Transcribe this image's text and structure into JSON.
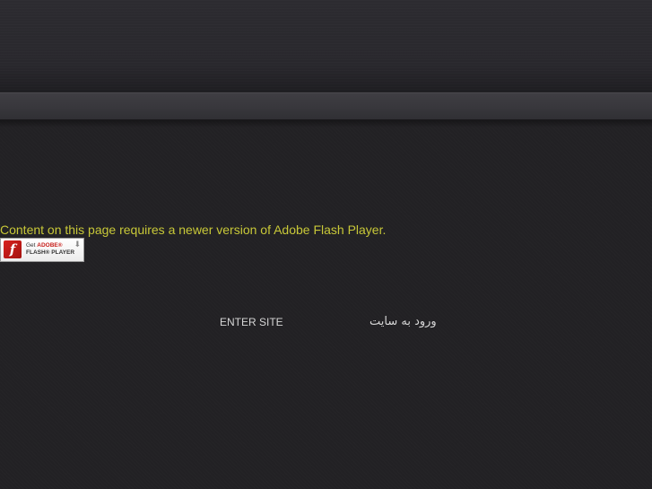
{
  "flash_notice": {
    "message": "Content on this page requires a newer version of Adobe Flash Player.",
    "badge": {
      "get_label": "Get",
      "brand_label": "ADOBE®",
      "product_label": "FLASH® PLAYER",
      "logo_glyph": "f",
      "download_glyph": "⬇"
    }
  },
  "entry_links": {
    "english": "ENTER SITE",
    "persian": "ورود به سایت"
  },
  "colors": {
    "background": "#222124",
    "nav_band": "#38373c",
    "notice_text": "#c8c838",
    "link_text": "#d6d6d6",
    "flash_red": "#c8201c"
  }
}
